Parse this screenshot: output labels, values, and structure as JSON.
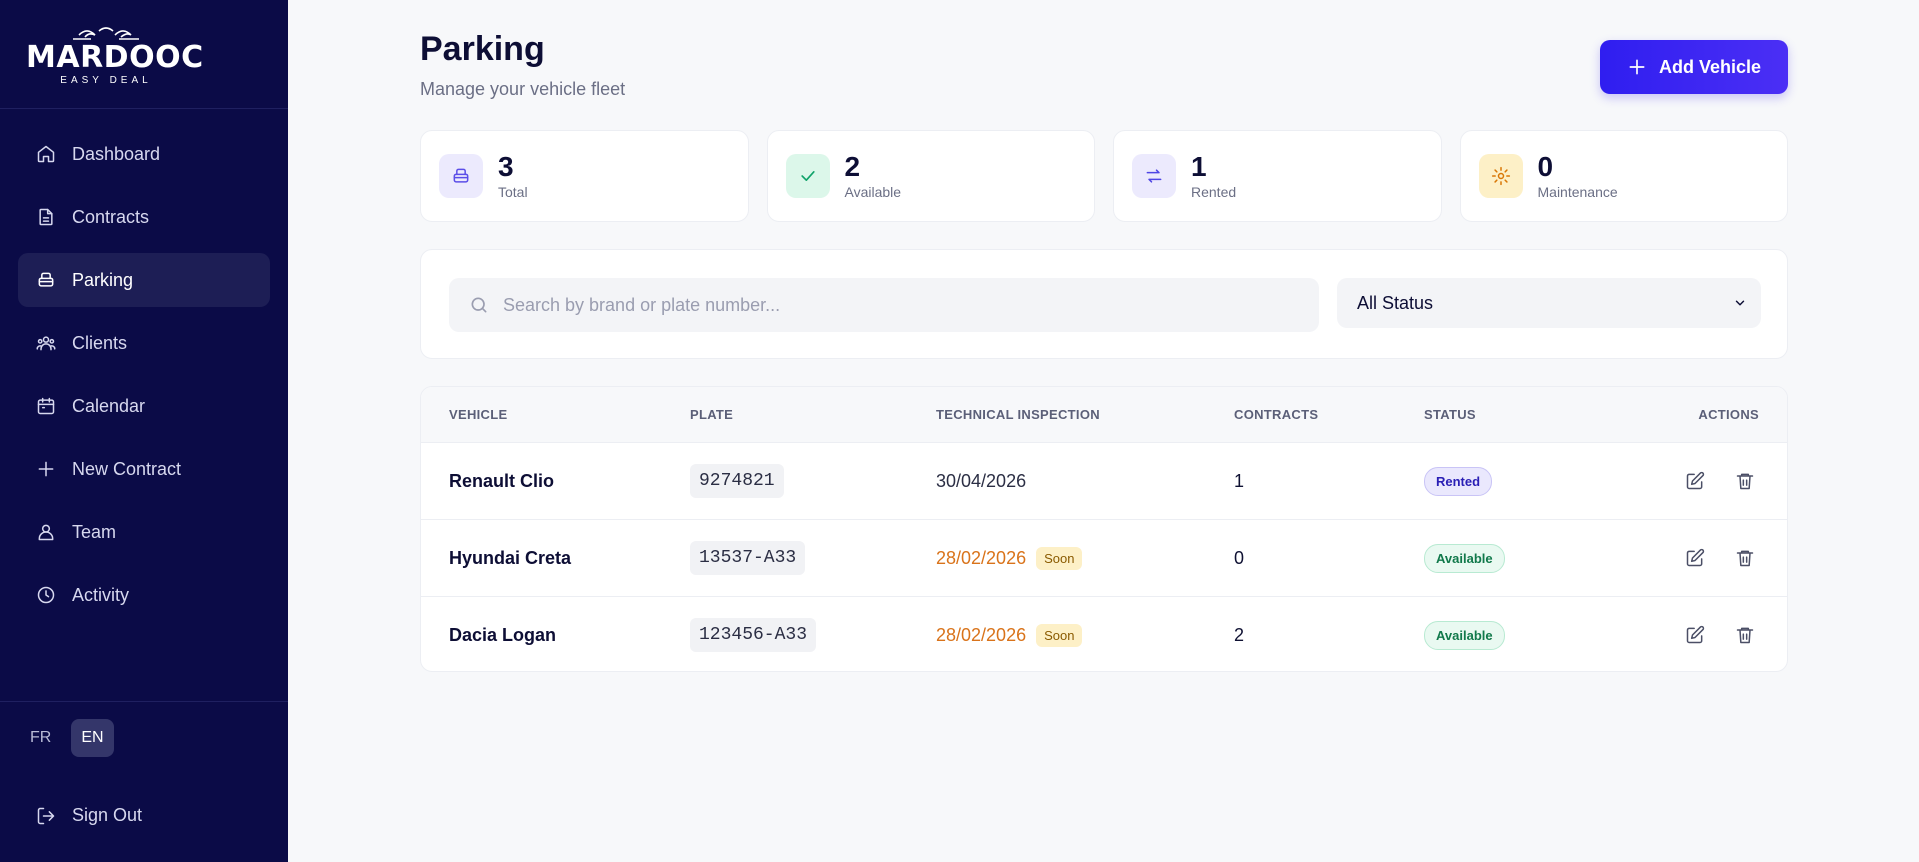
{
  "brand": {
    "name": "MARDOOC",
    "tagline": "EASY DEAL"
  },
  "sidebar": {
    "items": [
      {
        "label": "Dashboard",
        "icon": "home-icon",
        "active": false
      },
      {
        "label": "Contracts",
        "icon": "document-icon",
        "active": false
      },
      {
        "label": "Parking",
        "icon": "car-icon",
        "active": true
      },
      {
        "label": "Clients",
        "icon": "users-icon",
        "active": false
      },
      {
        "label": "Calendar",
        "icon": "calendar-icon",
        "active": false
      },
      {
        "label": "New Contract",
        "icon": "plus-icon",
        "active": false
      },
      {
        "label": "Team",
        "icon": "team-icon",
        "active": false
      },
      {
        "label": "Activity",
        "icon": "clock-icon",
        "active": false
      }
    ],
    "languages": {
      "fr": "FR",
      "en": "EN",
      "selected": "EN"
    },
    "sign_out": "Sign Out"
  },
  "header": {
    "title": "Parking",
    "subtitle": "Manage your vehicle fleet",
    "add_button": "Add Vehicle"
  },
  "stats": [
    {
      "value": "3",
      "label": "Total",
      "icon": "car-icon",
      "color": "#6c5ce7"
    },
    {
      "value": "2",
      "label": "Available",
      "icon": "check-icon",
      "color": "#10b981"
    },
    {
      "value": "1",
      "label": "Rented",
      "icon": "swap-icon",
      "color": "#4f46e5"
    },
    {
      "value": "0",
      "label": "Maintenance",
      "icon": "gear-icon",
      "color": "#d97706"
    }
  ],
  "filters": {
    "search_placeholder": "Search by brand or plate number...",
    "status_selected": "All Status"
  },
  "table": {
    "columns": [
      "VEHICLE",
      "PLATE",
      "TECHNICAL INSPECTION",
      "CONTRACTS",
      "STATUS",
      "ACTIONS"
    ],
    "rows": [
      {
        "vehicle": "Renault Clio",
        "plate": "9274821",
        "inspection": "30/04/2026",
        "soon": "",
        "contracts": "1",
        "status": "Rented"
      },
      {
        "vehicle": "Hyundai Creta",
        "plate": "13537-A33",
        "inspection": "28/02/2026",
        "soon": "Soon",
        "contracts": "0",
        "status": "Available"
      },
      {
        "vehicle": "Dacia Logan",
        "plate": "123456-A33",
        "inspection": "28/02/2026",
        "soon": "Soon",
        "contracts": "2",
        "status": "Available"
      }
    ]
  },
  "colors": {
    "sidebar_bg": "#0b0b47",
    "accent": "#3b24f2",
    "soon_date": "#d9731a",
    "rented_badge": "#2a1fb5",
    "available_badge": "#11794b"
  }
}
